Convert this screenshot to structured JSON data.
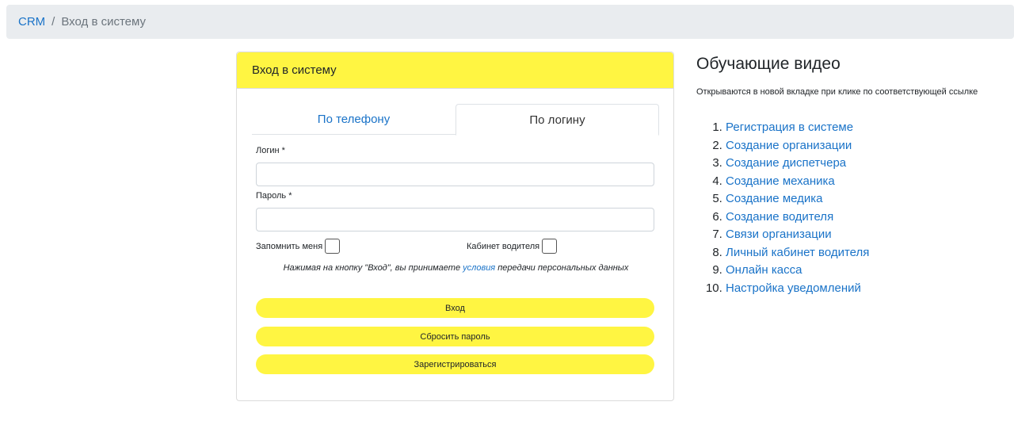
{
  "breadcrumb": {
    "root": "CRM",
    "separator": "/",
    "current": "Вход в систему"
  },
  "login_card": {
    "header": "Вход в систему",
    "tabs": [
      {
        "label": "По телефону",
        "active": false
      },
      {
        "label": "По логину",
        "active": true
      }
    ],
    "login_label": "Логин *",
    "login_value": "",
    "password_label": "Пароль *",
    "password_value": "",
    "remember_label": "Запомнить меня",
    "driver_cabinet_label": "Кабинет водителя",
    "notice_before": "Нажимая на кнопку \"Вход\", вы принимаете ",
    "notice_link": "условия",
    "notice_after": " передачи персональных данных",
    "login_button": "Вход",
    "reset_button": "Сбросить пароль",
    "register_button": "Зарегистрироваться"
  },
  "videos": {
    "title": "Обучающие видео",
    "subtitle": "Открываются в новой вкладке при клике по соответствующей ссылке",
    "items": [
      "Регистрация в системе",
      "Создание организации",
      "Создание диспетчера",
      "Создание механика",
      "Создание медика",
      "Создание водителя",
      "Связи организации",
      "Личный кабинет водителя",
      "Онлайн касса",
      "Настройка уведомлений"
    ]
  },
  "colors": {
    "accent_yellow": "#fff542",
    "link_blue": "#1a73c8",
    "breadcrumb_bg": "#e9ecef"
  }
}
